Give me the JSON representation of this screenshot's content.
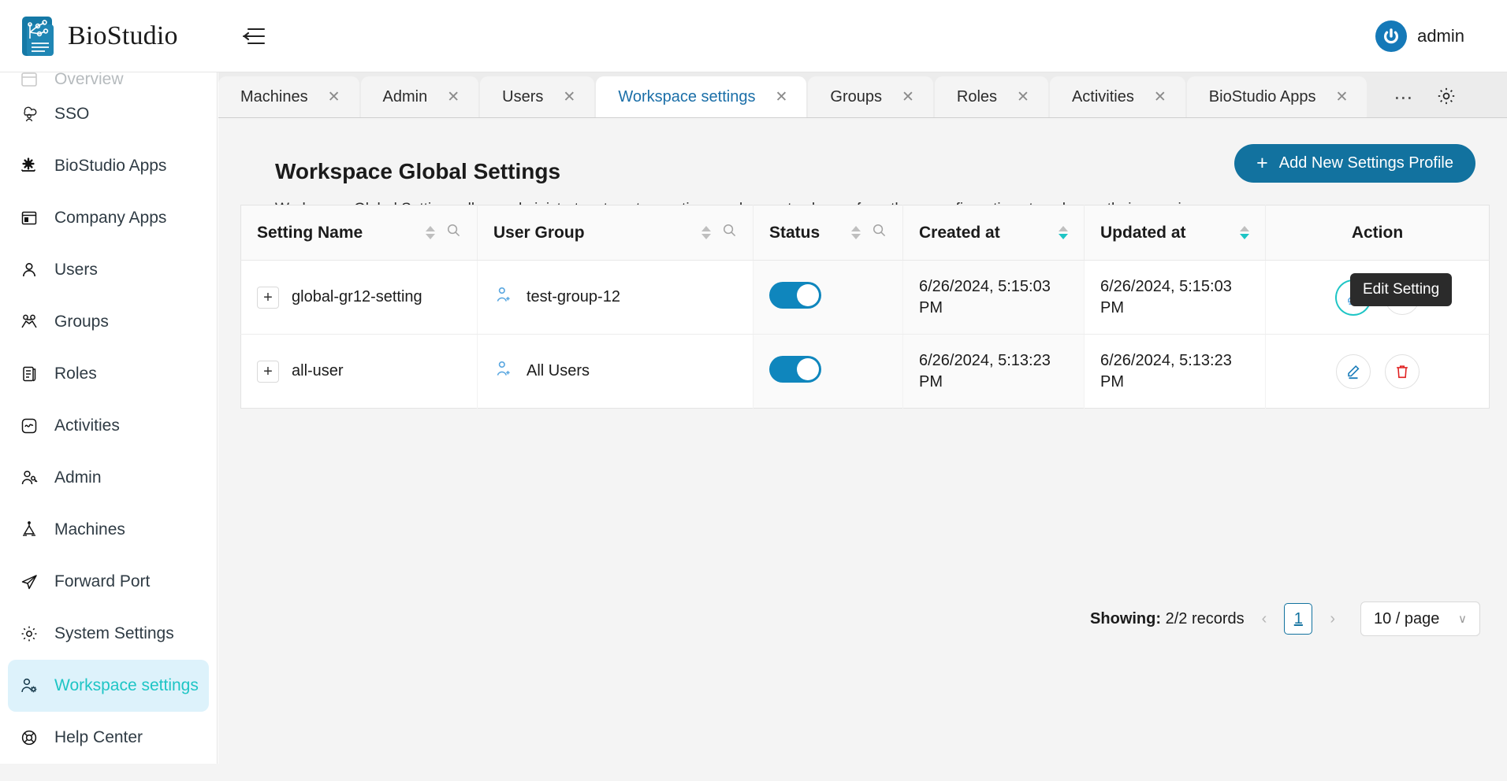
{
  "header": {
    "brand": "BioStudio",
    "logo_icon": "biostudio-logo-icon",
    "menu_icon": "collapse-menu-icon",
    "user": "admin",
    "avatar_icon": "power-avatar-icon"
  },
  "sidebar": {
    "clipped_top_label": "Overview",
    "items": [
      {
        "label": "SSO",
        "icon": "sso-cloud-icon",
        "active": false
      },
      {
        "label": "BioStudio Apps",
        "icon": "gear-app-icon",
        "active": false
      },
      {
        "label": "Company Apps",
        "icon": "window-app-icon",
        "active": false
      },
      {
        "label": "Users",
        "icon": "user-icon",
        "active": false
      },
      {
        "label": "Groups",
        "icon": "groups-icon",
        "active": false
      },
      {
        "label": "Roles",
        "icon": "roles-scroll-icon",
        "active": false
      },
      {
        "label": "Activities",
        "icon": "activity-pulse-icon",
        "active": false
      },
      {
        "label": "Admin",
        "icon": "user-key-icon",
        "active": false
      },
      {
        "label": "Machines",
        "icon": "machine-icon",
        "active": false
      },
      {
        "label": "Forward Port",
        "icon": "paper-plane-icon",
        "active": false
      },
      {
        "label": "System Settings",
        "icon": "gear-icon",
        "active": false
      },
      {
        "label": "Workspace settings",
        "icon": "user-gear-icon",
        "active": true
      },
      {
        "label": "Help Center",
        "icon": "lifebuoy-icon",
        "active": false
      }
    ]
  },
  "tabs": {
    "items": [
      {
        "label": "Machines",
        "active": false
      },
      {
        "label": "Admin",
        "active": false
      },
      {
        "label": "Users",
        "active": false
      },
      {
        "label": "Workspace settings",
        "active": true
      },
      {
        "label": "Groups",
        "active": false
      },
      {
        "label": "Roles",
        "active": false
      },
      {
        "label": "Activities",
        "active": false
      },
      {
        "label": "BioStudio Apps",
        "active": false
      }
    ],
    "close_glyph": "✕",
    "more_glyph": "⋯",
    "more_icon": "tab-overflow-icon",
    "settings_icon": "tab-settings-gear-icon"
  },
  "main": {
    "title": "Workspace Global Settings",
    "description": "Workspace Global Settings allows administrators to set up options and users to choose from these configurations to enhance their experience.",
    "add_button": {
      "label": "Add New Settings Profile",
      "plus": "+",
      "color": "#12729f"
    }
  },
  "table": {
    "columns": [
      {
        "label": "Setting Name",
        "sortable": true,
        "searchable": true,
        "sorted": "none"
      },
      {
        "label": "User Group",
        "sortable": true,
        "searchable": true,
        "sorted": "none"
      },
      {
        "label": "Status",
        "sortable": true,
        "searchable": true,
        "sorted": "none"
      },
      {
        "label": "Created at",
        "sortable": true,
        "searchable": false,
        "sorted": "desc"
      },
      {
        "label": "Updated at",
        "sortable": true,
        "searchable": false,
        "sorted": "desc"
      },
      {
        "label": "Action",
        "sortable": false,
        "searchable": false,
        "sorted": "none"
      }
    ],
    "rows": [
      {
        "expander": "+",
        "setting_name": "global-gr12-setting",
        "user_group": "test-group-12",
        "group_icon": "user-group-add-icon",
        "status_on": true,
        "created_at": "6/26/2024, 5:15:03 PM",
        "updated_at": "6/26/2024, 5:15:03 PM",
        "edit_icon": "pencil-edit-icon",
        "delete_icon": "trash-delete-icon",
        "edit_focused": true
      },
      {
        "expander": "+",
        "setting_name": "all-user",
        "user_group": "All Users",
        "group_icon": "user-group-add-icon",
        "status_on": true,
        "created_at": "6/26/2024, 5:13:23 PM",
        "updated_at": "6/26/2024, 5:13:23 PM",
        "edit_icon": "pencil-edit-icon",
        "delete_icon": "trash-delete-icon",
        "edit_focused": false
      }
    ]
  },
  "pagination": {
    "showing_label": "Showing:",
    "records": "2/2 records",
    "prev_glyph": "‹",
    "next_glyph": "›",
    "current_page": "1",
    "page_size": "10 / page",
    "caret": "∨"
  },
  "tooltip": {
    "text": "Edit Setting"
  },
  "colors": {
    "accent_blue": "#12729f",
    "accent_teal": "#1ec5c5",
    "active_nav_bg": "#ddf2fb",
    "delete_red": "#e02020"
  }
}
